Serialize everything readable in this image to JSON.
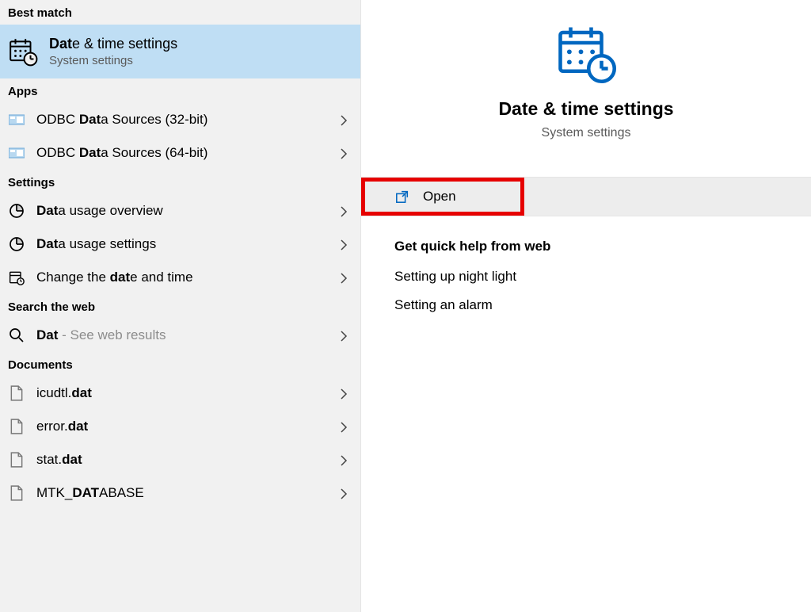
{
  "left": {
    "best_match_header": "Best match",
    "best_match": {
      "title_pre_bold": "Dat",
      "title_rest": "e & time settings",
      "subtitle": "System settings"
    },
    "apps_header": "Apps",
    "apps": [
      {
        "pre": "ODBC ",
        "bold": "Dat",
        "post": "a Sources (32-bit)"
      },
      {
        "pre": "ODBC ",
        "bold": "Dat",
        "post": "a Sources (64-bit)"
      }
    ],
    "settings_header": "Settings",
    "settings": [
      {
        "pre": "",
        "bold": "Dat",
        "post": "a usage overview"
      },
      {
        "pre": "",
        "bold": "Dat",
        "post": "a usage settings"
      },
      {
        "pre": "Change the ",
        "bold": "dat",
        "post": "e and time"
      }
    ],
    "web_header": "Search the web",
    "web": {
      "bold": "Dat",
      "hint": " - See web results"
    },
    "docs_header": "Documents",
    "docs": [
      {
        "pre": "icudtl.",
        "bold": "dat",
        "post": ""
      },
      {
        "pre": "error.",
        "bold": "dat",
        "post": ""
      },
      {
        "pre": "stat.",
        "bold": "dat",
        "post": ""
      },
      {
        "pre": "MTK_",
        "bold": "DAT",
        "post": "ABASE"
      }
    ]
  },
  "right": {
    "title": "Date & time settings",
    "subtitle": "System settings",
    "open_label": "Open",
    "quick_help_title": "Get quick help from web",
    "quick_help_links": [
      "Setting up night light",
      "Setting an alarm"
    ]
  },
  "colors": {
    "accent": "#0067c0",
    "selection": "#bfdef4",
    "highlight_border": "#e60000"
  }
}
